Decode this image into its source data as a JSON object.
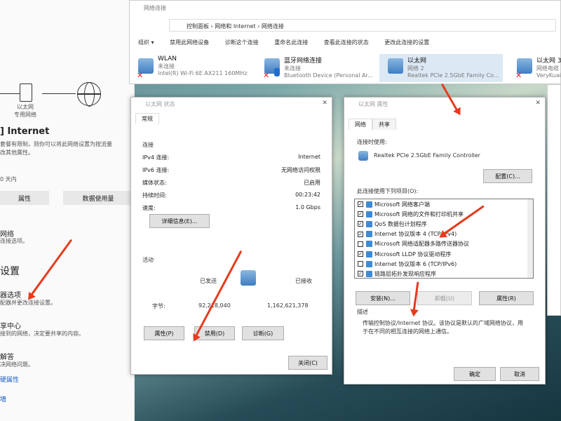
{
  "settings": {
    "diagram_label_1": "以太网",
    "diagram_label_2": "专用网络",
    "status_title": "] Internet",
    "status_desc_1": "套餐有限制，则你可以将此网络设置为按流量",
    "status_desc_2": "改其他属性。",
    "data_range": "0 天内",
    "btn_properties": "属性",
    "btn_data_usage": "数据使用量",
    "item_network": "网络",
    "item_network_desc": "连接选项。",
    "section_heading": "设置",
    "item_adapter": "器选项",
    "item_adapter_desc": "配器并更改连接设置。",
    "item_sharing": "享中心",
    "item_sharing_desc": "接到的网络，决定要共享的内容。",
    "item_troubleshoot": "解答",
    "item_troubleshoot_desc": "决网络问题。",
    "link_properties": "硬属性",
    "link_firewall": "墙"
  },
  "netwin": {
    "title": "网络连接",
    "breadcrumb": "控制面板  ›  网络和 Internet  ›  网络连接",
    "toolbar": [
      "组织 ▾",
      "禁用此网络设备",
      "诊断这个连接",
      "重命名此连接",
      "查看此连接的状态",
      "更改此连接的设置"
    ],
    "connections": [
      {
        "name": "WLAN",
        "status": "未连接",
        "device": "Intel(R) Wi-Fi 6E AX211 160MHz"
      },
      {
        "name": "蓝牙网络连接",
        "status": "未连接",
        "device": "Bluetooth Device (Personal Ar..."
      },
      {
        "name": "以太网",
        "status": "网络 2",
        "device": "Realtek PCIe 2.5GbE Family Co..."
      },
      {
        "name": "以太网 3",
        "status": "网络电缆",
        "device": "VeryKuai Ta"
      }
    ]
  },
  "status_dialog": {
    "title": "以太网 状态",
    "tab": "常规",
    "connection_label": "连接",
    "rows": [
      {
        "k": "IPv4 连接:",
        "v": "Internet"
      },
      {
        "k": "IPv6 连接:",
        "v": "无网络访问权限"
      },
      {
        "k": "媒体状态:",
        "v": "已启用"
      },
      {
        "k": "持续时间:",
        "v": "00:23:42"
      },
      {
        "k": "速度:",
        "v": "1.0 Gbps"
      }
    ],
    "details_btn": "详细信息(E)...",
    "activity_label": "活动",
    "sent_label": "已发送",
    "recv_label": "已接收",
    "bytes_label": "字节:",
    "bytes_sent": "92,218,040",
    "bytes_recv": "1,162,621,378",
    "btn_properties": "属性(P)",
    "btn_disable": "禁用(D)",
    "btn_diagnose": "诊断(G)",
    "btn_close": "关闭(C)"
  },
  "props_dialog": {
    "title": "以太网 属性",
    "tabs": [
      "网络",
      "共享"
    ],
    "connect_using": "连接时使用:",
    "adapter": "Realtek PCIe 2.5GbE Family Controller",
    "configure_btn": "配置(C)...",
    "items_label": "此连接使用下列项目(O):",
    "items": [
      {
        "label": "Microsoft 网络客户端",
        "checked": "✓"
      },
      {
        "label": "Microsoft 网络的文件和打印机共享",
        "checked": "✓"
      },
      {
        "label": "QoS 数据包计划程序",
        "checked": "✓"
      },
      {
        "label": "Internet 协议版本 4 (TCP/IPv4)",
        "checked": "✓"
      },
      {
        "label": "Microsoft 网络适配器多路传送器协议",
        "checked": ""
      },
      {
        "label": "Microsoft LLDP 协议驱动程序",
        "checked": "✓"
      },
      {
        "label": "Internet 协议版本 6 (TCP/IPv6)",
        "checked": ""
      },
      {
        "label": "链路层拓扑发现响应程序",
        "checked": "✓"
      }
    ],
    "install_btn": "安装(N)...",
    "uninstall_btn": "卸载(U)",
    "properties_btn": "属性(R)",
    "desc_label": "描述",
    "desc_text_1": "传输控制协议/Internet 协议。该协议是默认的广域网络协议，用",
    "desc_text_2": "于在不同的相互连接的网络上通信。",
    "ok_btn": "确定",
    "cancel_btn": "取消"
  },
  "colors": {
    "arrow": "#e63b1e",
    "selected": "#dce9f5"
  }
}
